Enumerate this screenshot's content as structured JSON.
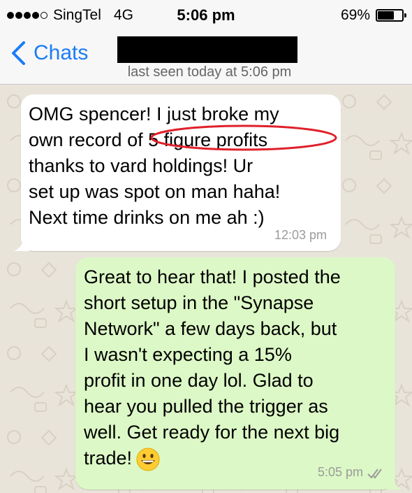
{
  "status_bar": {
    "carrier": "SingTel",
    "network": "4G",
    "time": "5:06 pm",
    "battery": "69%",
    "battery_level": 0.69
  },
  "nav": {
    "back_label": "Chats",
    "last_seen": "last seen today at 5:06 pm"
  },
  "messages": [
    {
      "direction": "incoming",
      "text": "OMG spencer! I just broke my\nown record of 5 figure profits\nthanks to vard holdings! Ur\nset up was spot on man haha!\nNext time drinks on me ah :)",
      "time": "12:03 pm"
    },
    {
      "direction": "outgoing",
      "text": "Great to hear that! I posted the\nshort setup in the \"Synapse\nNetwork\" a few days back, but\nI wasn't expecting a 15%\nprofit in one day lol. Glad to\nhear you pulled the trigger as\nwell. Get ready for the next big\ntrade!",
      "time": "5:05 pm",
      "emoji": "grinning-face"
    }
  ],
  "colors": {
    "accent": "#1a7cf5",
    "outgoing_bubble": "#dcf8c6",
    "incoming_bubble": "#ffffff",
    "highlight": "#e0202a",
    "wallpaper": "#e9e4da"
  }
}
